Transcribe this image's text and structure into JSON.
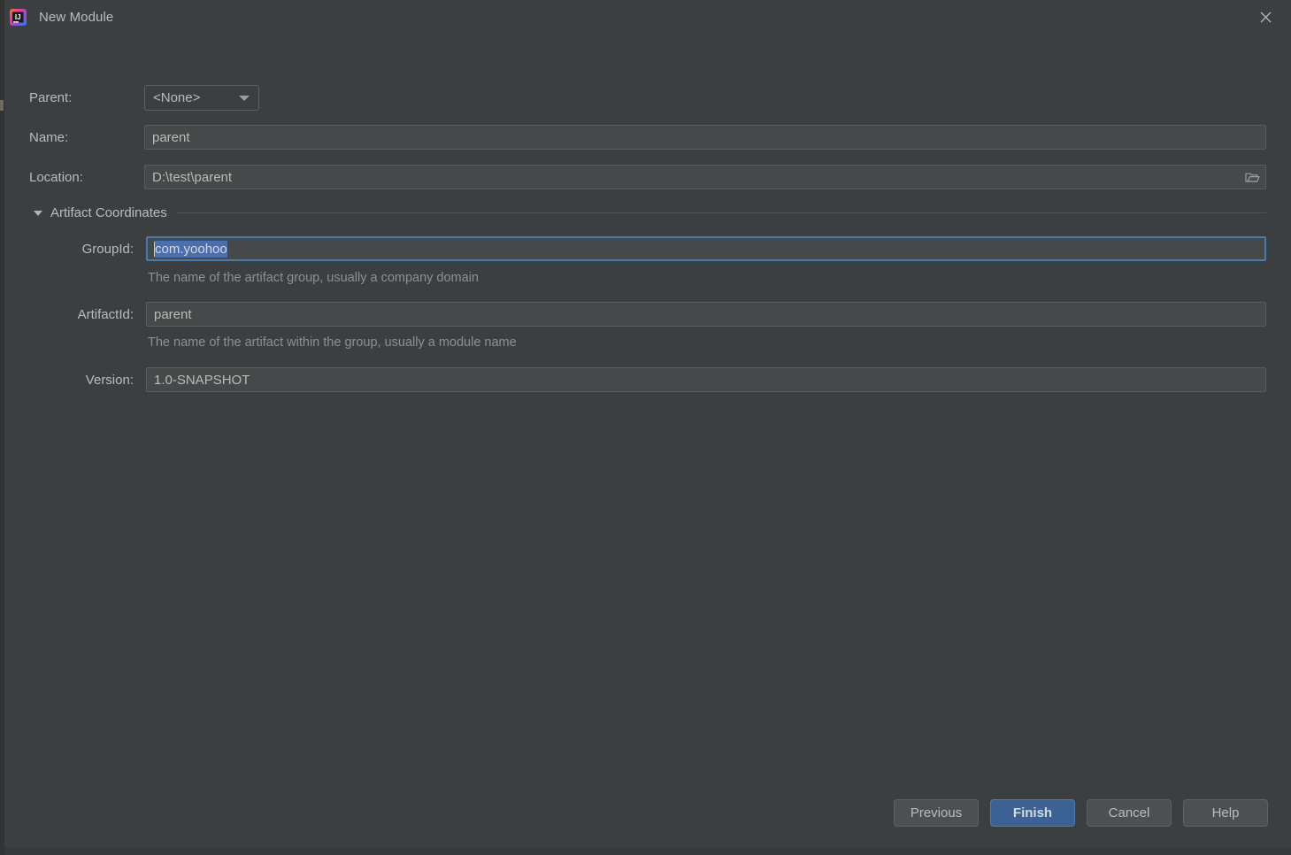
{
  "window": {
    "title": "New Module",
    "app_icon": "intellij-idea-logo",
    "close_icon": "close-icon"
  },
  "form": {
    "parent": {
      "label": "Parent:",
      "value": "<None>",
      "chevron_icon": "chevron-down-icon"
    },
    "name": {
      "label": "Name:",
      "value": "parent"
    },
    "location": {
      "label": "Location:",
      "value": "D:\\test\\parent",
      "browse_icon": "folder-icon"
    }
  },
  "artifact_section": {
    "label": "Artifact Coordinates",
    "expanded": true,
    "triangle_icon": "triangle-down-icon",
    "group_id": {
      "label": "GroupId:",
      "value": "com.yoohoo",
      "selected": true,
      "hint": "The name of the artifact group, usually a company domain"
    },
    "artifact_id": {
      "label": "ArtifactId:",
      "value": "parent",
      "hint": "The name of the artifact within the group, usually a module name"
    },
    "version": {
      "label": "Version:",
      "value": "1.0-SNAPSHOT"
    }
  },
  "buttons": {
    "previous": "Previous",
    "finish": "Finish",
    "cancel": "Cancel",
    "help": "Help"
  },
  "colors": {
    "dialog_bg": "#3c3f41",
    "field_bg": "#45494a",
    "text": "#bbbbbb",
    "hint_text": "#8d9091",
    "focus_border": "#4a7aa8",
    "selection_bg": "#4b6eaf",
    "primary_button": "#3c6293"
  }
}
